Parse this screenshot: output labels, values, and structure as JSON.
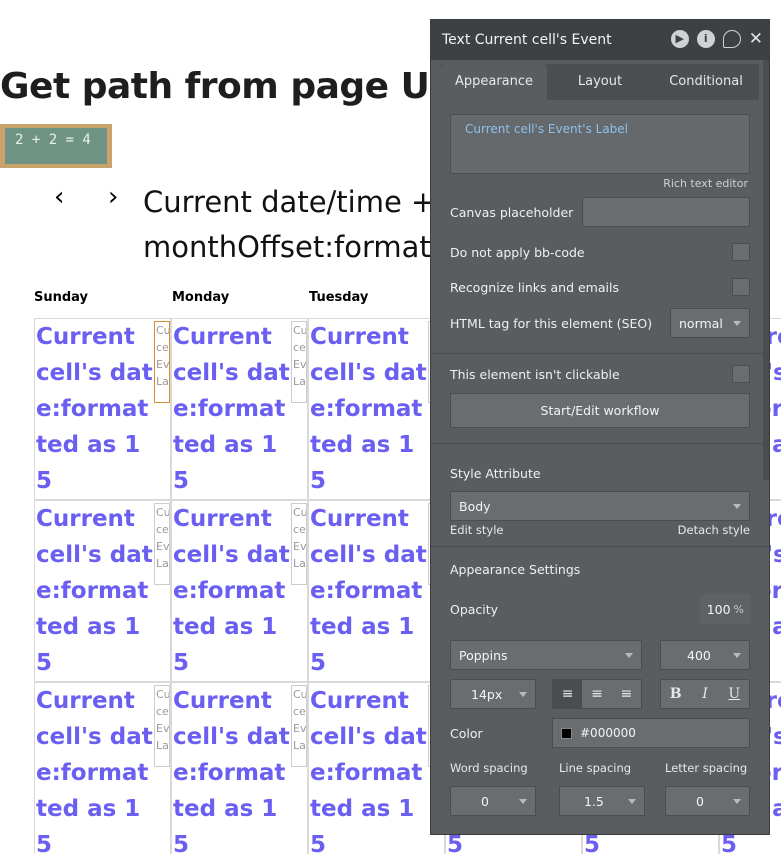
{
  "page": {
    "title": "Get path from page URL",
    "chalk_text": "2 + 2 = 4",
    "prev": "‹",
    "next": "›",
    "date_line1": "Current date/time +",
    "date_line2": "monthOffset:formatted"
  },
  "calendar": {
    "days": [
      "Sunday",
      "Monday",
      "Tuesday"
    ],
    "cell_date": "Current cell's date:formatted as 15",
    "cell_event": "Cu\nce\nEv\nLa"
  },
  "panel": {
    "title": "Text Current cell's Event",
    "icons": {
      "play": "play-icon",
      "info": "info-icon",
      "comment": "comment-icon",
      "close": "close-icon"
    },
    "tabs": [
      "Appearance",
      "Layout",
      "Conditional"
    ],
    "label_value": "Current cell's Event's Label",
    "rich_editor": "Rich text editor",
    "canvas_placeholder": "Canvas placeholder",
    "no_bbcode": "Do not apply bb-code",
    "recognize_links": "Recognize links and emails",
    "html_tag_label": "HTML tag for this element (SEO)",
    "html_tag_value": "normal",
    "not_clickable": "This element isn't clickable",
    "workflow_button": "Start/Edit workflow",
    "style_attribute": "Style Attribute",
    "style_value": "Body",
    "edit_style": "Edit style",
    "detach_style": "Detach style",
    "appearance_settings": "Appearance Settings",
    "opacity_label": "Opacity",
    "opacity_value": "100",
    "opacity_unit": "%",
    "font_value": "Poppins",
    "weight_value": "400",
    "size_value": "14px",
    "bold": "B",
    "italic": "I",
    "underline": "U",
    "color_label": "Color",
    "color_value": "#000000",
    "word_spacing": "Word spacing",
    "line_spacing": "Line spacing",
    "letter_spacing": "Letter spacing",
    "word_spacing_value": "0",
    "line_spacing_value": "1.5",
    "letter_spacing_value": "0"
  }
}
